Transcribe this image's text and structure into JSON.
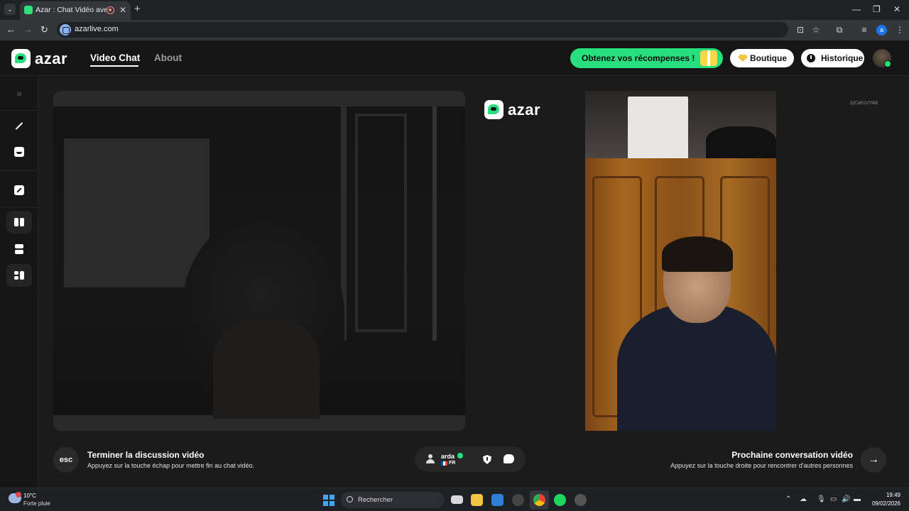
{
  "browser": {
    "tab_title": "Azar : Chat Vidéo avec de n",
    "url": "azarlive.com",
    "profile_initial": "a"
  },
  "header": {
    "logo_text": "azar",
    "nav": {
      "video_chat": "Video Chat",
      "about": "About"
    },
    "rewards_label": "Obtenez vos récompenses !",
    "shop_label": "Boutique",
    "history_label": "Historique"
  },
  "main": {
    "center_logo_text": "azar",
    "room_id": "JyCah2xYA8"
  },
  "controls": {
    "esc_label": "esc",
    "end_title": "Terminer la discussion vidéo",
    "end_desc": "Appuyez sur la touche échap pour mettre fin au chat vidéo.",
    "partner_name": "arda",
    "partner_country": "FR",
    "next_title": "Prochaine conversation vidéo",
    "next_desc": "Appuyez sur la touche droite pour rencontrer d'autres personnes"
  },
  "taskbar": {
    "temperature": "10°C",
    "weather": "Forte pluie",
    "search_placeholder": "Rechercher",
    "time": "19:49",
    "date": "09/02/2026"
  },
  "colors": {
    "accent": "#27e07d",
    "background": "#1b1b1b"
  }
}
